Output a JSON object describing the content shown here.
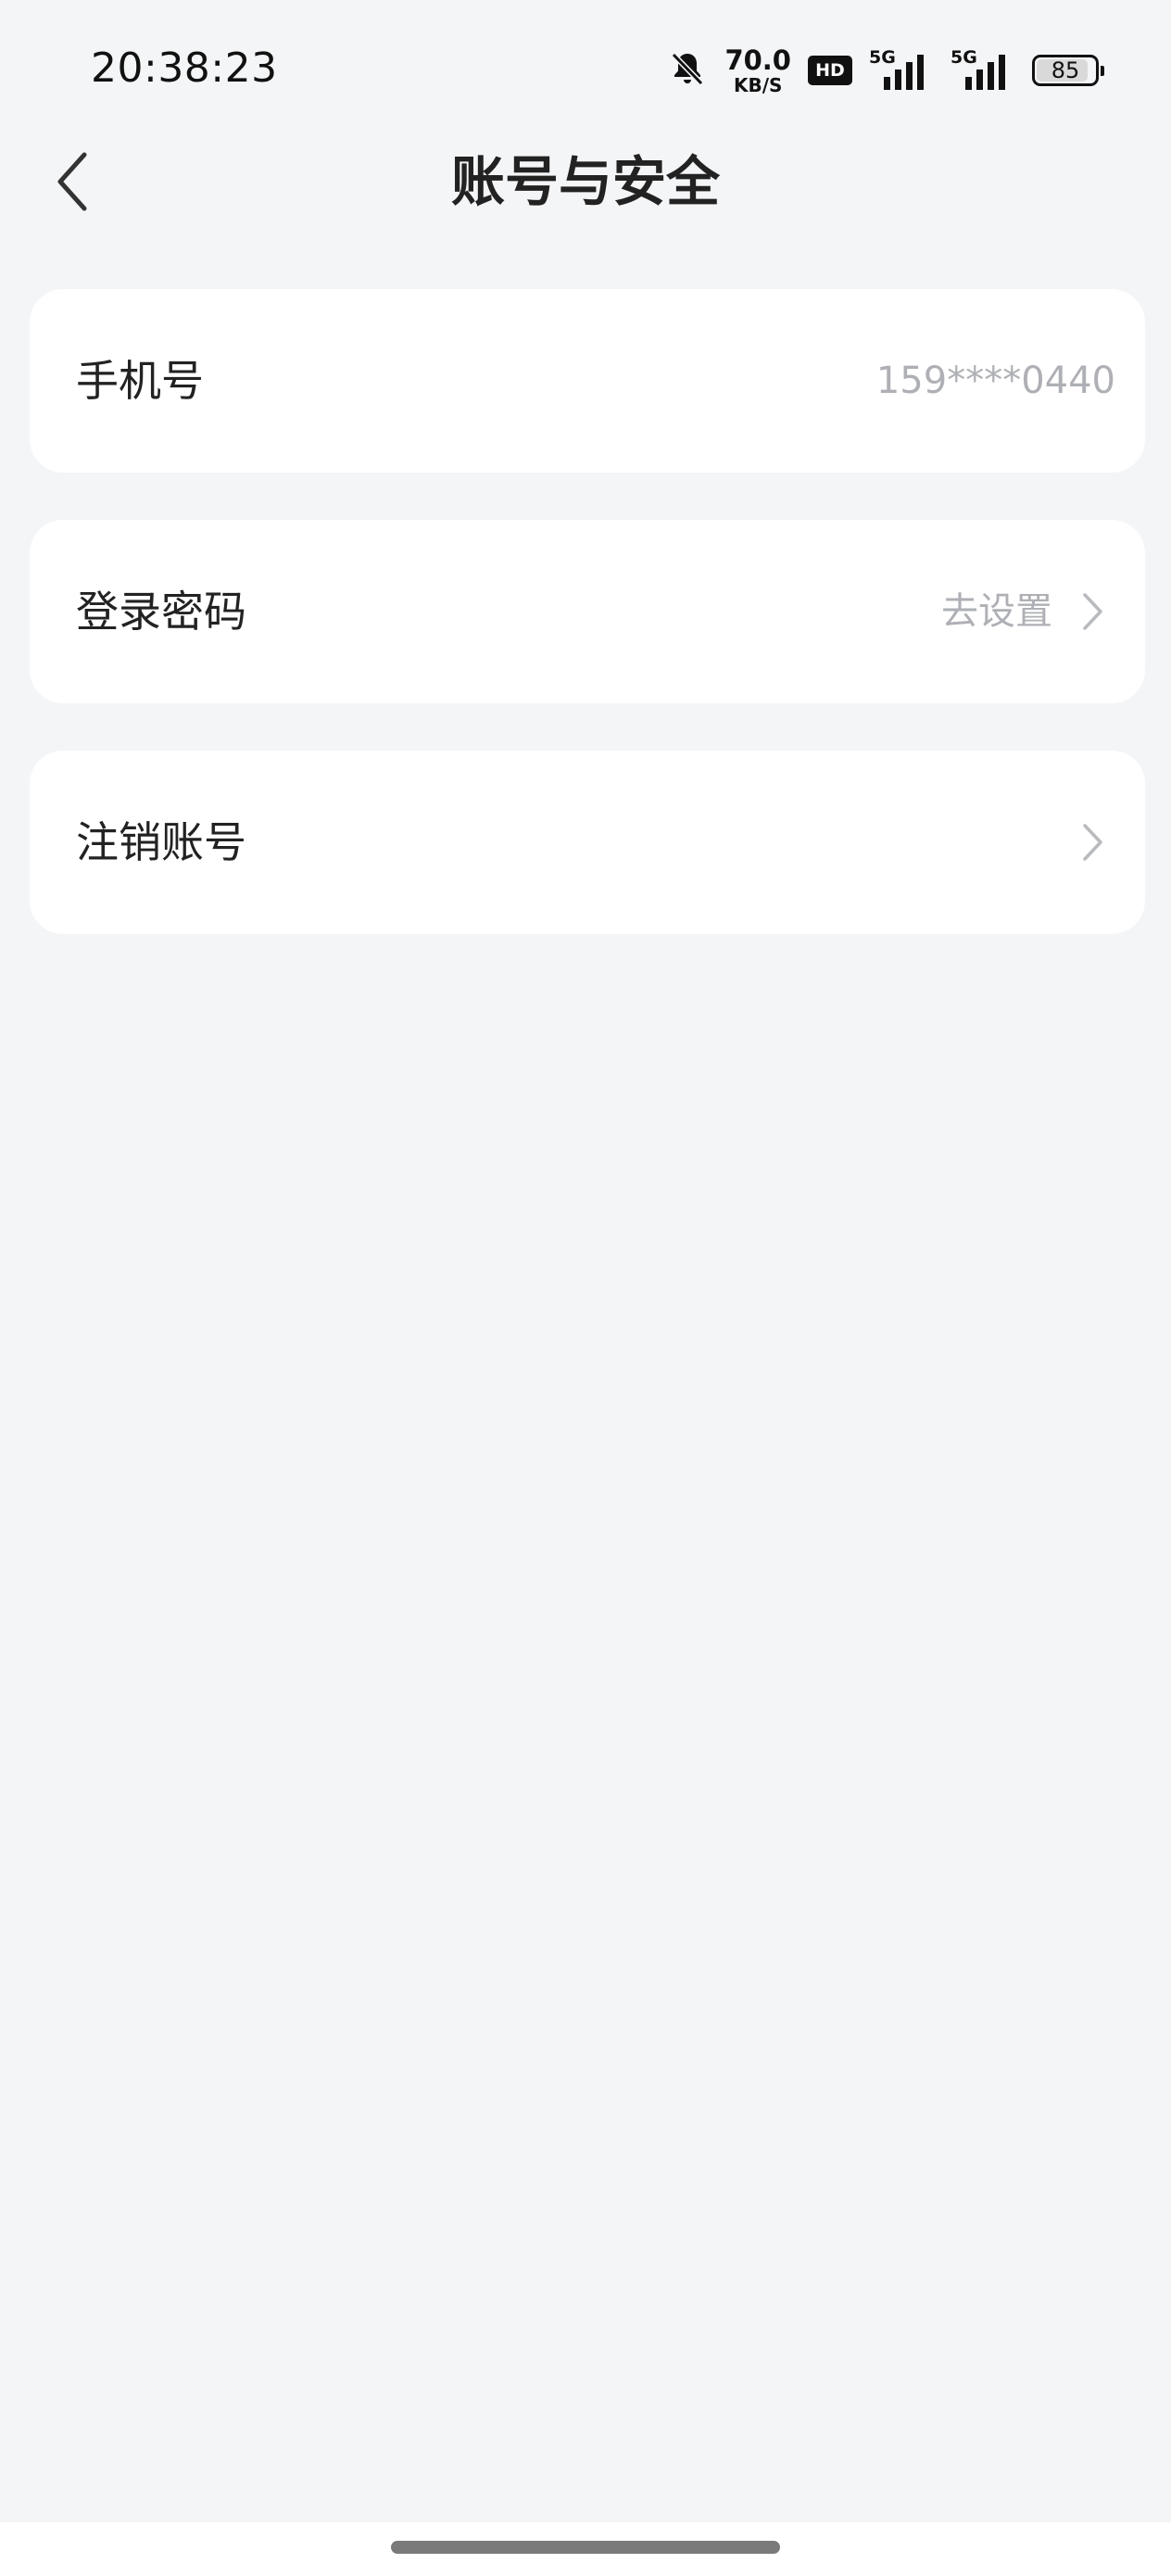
{
  "status_bar": {
    "time": "20:38:23",
    "net_speed_value": "70.0",
    "net_speed_unit": "KB/S",
    "hd_badge": "HD",
    "signal_1_label": "5G",
    "signal_2_label": "5G",
    "battery_level": "85",
    "icons": [
      "bell-off-icon",
      "hd-icon",
      "signal-icon",
      "signal-icon",
      "battery-icon"
    ]
  },
  "nav": {
    "title": "账号与安全",
    "back_icon": "chevron-left-icon"
  },
  "settings": {
    "phone": {
      "label": "手机号",
      "value": "159****0440"
    },
    "password": {
      "label": "登录密码",
      "value": "去设置",
      "icon": "chevron-right-icon"
    },
    "delete_account": {
      "label": "注销账号",
      "icon": "chevron-right-icon"
    }
  },
  "colors": {
    "background": "#F4F5F7",
    "card": "#FFFFFF",
    "text_primary": "#222222",
    "text_secondary": "#AEB0B5"
  }
}
